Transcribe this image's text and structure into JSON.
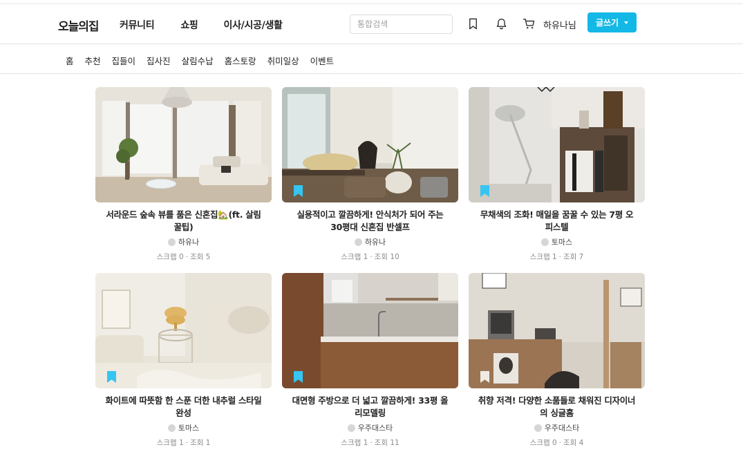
{
  "brand": {
    "logo": "오늘의집",
    "accent": "#14b8e6"
  },
  "header": {
    "nav": [
      "커뮤니티",
      "쇼핑",
      "이사/시공/생활"
    ],
    "search_placeholder": "통합검색",
    "icons": [
      "bookmark-icon",
      "bell-icon",
      "cart-icon"
    ],
    "user": "하유나님",
    "write_label": "글쓰기"
  },
  "subnav": [
    "홈",
    "추천",
    "집들이",
    "집사진",
    "살림수납",
    "홈스토랑",
    "취미일상",
    "이벤트"
  ],
  "cards": [
    {
      "title": "서라운드 숲속 뷰를 품은 신혼집🏡(ft. 살림 꿀팁)",
      "author": "하유나",
      "scrap_label": "스크랩",
      "scrap": "0",
      "view_label": "조회",
      "views": "5",
      "bookmarked": false
    },
    {
      "title": "실용적이고 깔끔하게! 안식처가 되어 주는 30평대 신혼집 반셀프",
      "author": "하유나",
      "scrap_label": "스크랩",
      "scrap": "1",
      "view_label": "조회",
      "views": "10",
      "bookmarked": true
    },
    {
      "title": "무채색의 조화! 매일을 꿈꿀 수 있는 7평 오피스텔",
      "author": "토마스",
      "scrap_label": "스크랩",
      "scrap": "1",
      "view_label": "조회",
      "views": "7",
      "bookmarked": true
    },
    {
      "title": "화이트에 따뜻함 한 스푼 더한 내추럴 스타일 완성",
      "author": "토마스",
      "scrap_label": "스크랩",
      "scrap": "1",
      "view_label": "조회",
      "views": "1",
      "bookmarked": true
    },
    {
      "title": "대면형 주방으로 더 넓고 깔끔하게! 33평 올리모델링",
      "author": "우주대스타",
      "scrap_label": "스크랩",
      "scrap": "1",
      "view_label": "조회",
      "views": "11",
      "bookmarked": true
    },
    {
      "title": "취향 저격! 다양한 소품들로 채워진 디자이너의 싱글홈",
      "author": "우주대스타",
      "scrap_label": "스크랩",
      "scrap": "0",
      "view_label": "조회",
      "views": "4",
      "bookmarked": true
    }
  ]
}
